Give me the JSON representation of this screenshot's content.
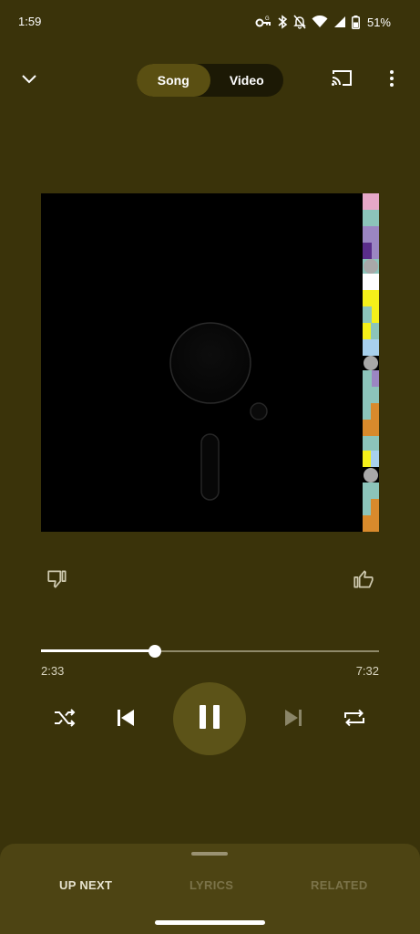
{
  "status": {
    "time": "1:59",
    "battery": "51%",
    "icons": [
      "vpn-key-icon",
      "bluetooth-icon",
      "notifications-off-icon",
      "wifi-icon",
      "signal-icon",
      "battery-icon"
    ]
  },
  "topbar": {
    "collapse_icon": "chevron-down-icon",
    "song_label": "Song",
    "video_label": "Video",
    "active_mode": "Song",
    "cast_icon": "cast-icon",
    "more_icon": "more-vert-icon"
  },
  "album_art": {
    "background": "#000000",
    "stripe_colors": [
      "#e6a8c8",
      "#8cc4ba",
      "#9b86c2",
      "#5a2d8a",
      "#ffffff",
      "#f5f01a",
      "#a8d0ec",
      "#d88a2c",
      "#a8a8a8"
    ]
  },
  "actions": {
    "dislike_icon": "thumb-down-icon",
    "like_icon": "thumb-up-icon"
  },
  "progress": {
    "elapsed": "2:33",
    "total": "7:32",
    "fraction": 0.338
  },
  "controls": {
    "shuffle_icon": "shuffle-icon",
    "previous_icon": "skip-previous-icon",
    "play_state_icon": "pause-icon",
    "next_icon": "skip-next-icon",
    "repeat_icon": "repeat-icon"
  },
  "bottom_tabs": {
    "up_next": "UP NEXT",
    "lyrics": "LYRICS",
    "related": "RELATED"
  },
  "colors": {
    "background": "#3a330a",
    "accent": "#5c5318",
    "sheet": "#4d4413"
  }
}
